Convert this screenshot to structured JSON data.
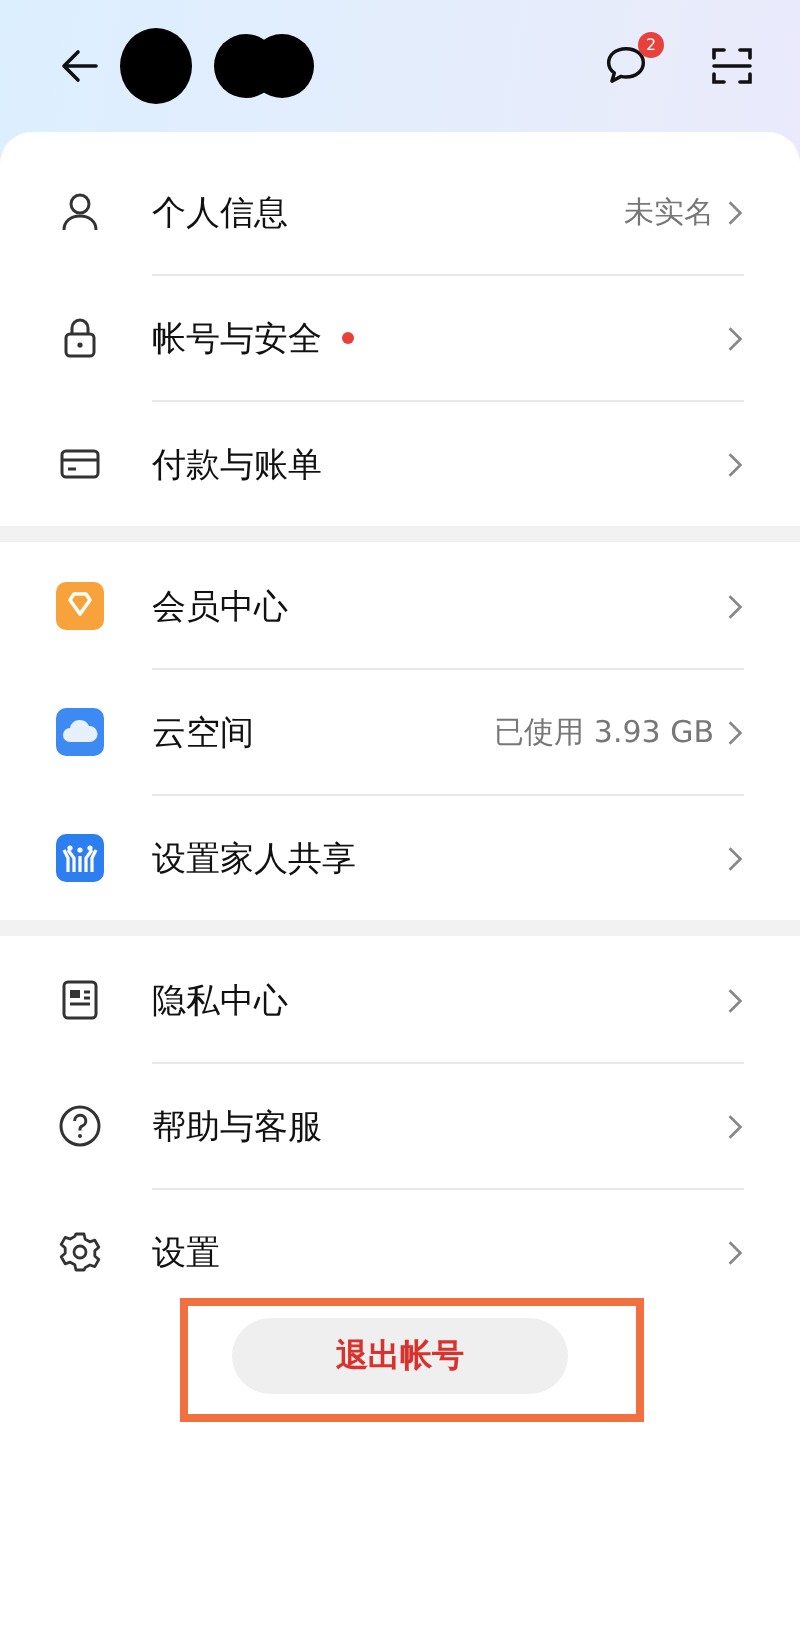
{
  "header": {
    "message_badge": "2"
  },
  "groups": [
    {
      "items": [
        {
          "label": "个人信息",
          "value": "未实名",
          "dot": false
        },
        {
          "label": "帐号与安全",
          "dot": true
        },
        {
          "label": "付款与账单",
          "dot": false
        }
      ]
    },
    {
      "items": [
        {
          "label": "会员中心",
          "dot": false
        },
        {
          "label": "云空间",
          "value": "已使用 3.93 GB",
          "dot": false
        },
        {
          "label": "设置家人共享",
          "dot": false
        }
      ]
    },
    {
      "items": [
        {
          "label": "隐私中心",
          "dot": false
        },
        {
          "label": "帮助与客服",
          "dot": false
        },
        {
          "label": "设置",
          "dot": false
        }
      ]
    }
  ],
  "logout": {
    "label": "退出帐号",
    "highlighted": true
  }
}
